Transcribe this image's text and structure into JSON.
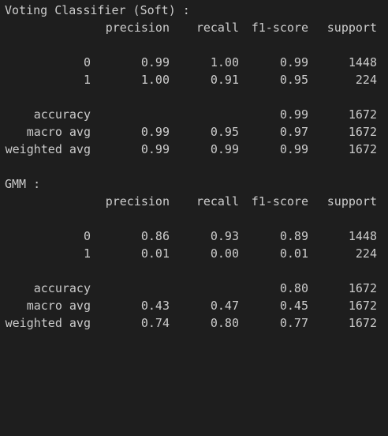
{
  "reports": [
    {
      "title": "Voting Classifier (Soft) :",
      "headers": {
        "precision": "precision",
        "recall": "recall",
        "f1": "f1-score",
        "support": "support"
      },
      "classes": [
        {
          "label": "0",
          "precision": "0.99",
          "recall": "1.00",
          "f1": "0.99",
          "support": "1448"
        },
        {
          "label": "1",
          "precision": "1.00",
          "recall": "0.91",
          "f1": "0.95",
          "support": "224"
        }
      ],
      "accuracy": {
        "label": "accuracy",
        "f1": "0.99",
        "support": "1672"
      },
      "macro_avg": {
        "label": "macro avg",
        "precision": "0.99",
        "recall": "0.95",
        "f1": "0.97",
        "support": "1672"
      },
      "weighted_avg": {
        "label": "weighted avg",
        "precision": "0.99",
        "recall": "0.99",
        "f1": "0.99",
        "support": "1672"
      }
    },
    {
      "title": "GMM :",
      "headers": {
        "precision": "precision",
        "recall": "recall",
        "f1": "f1-score",
        "support": "support"
      },
      "classes": [
        {
          "label": "0",
          "precision": "0.86",
          "recall": "0.93",
          "f1": "0.89",
          "support": "1448"
        },
        {
          "label": "1",
          "precision": "0.01",
          "recall": "0.00",
          "f1": "0.01",
          "support": "224"
        }
      ],
      "accuracy": {
        "label": "accuracy",
        "f1": "0.80",
        "support": "1672"
      },
      "macro_avg": {
        "label": "macro avg",
        "precision": "0.43",
        "recall": "0.47",
        "f1": "0.45",
        "support": "1672"
      },
      "weighted_avg": {
        "label": "weighted avg",
        "precision": "0.74",
        "recall": "0.80",
        "f1": "0.77",
        "support": "1672"
      }
    }
  ]
}
